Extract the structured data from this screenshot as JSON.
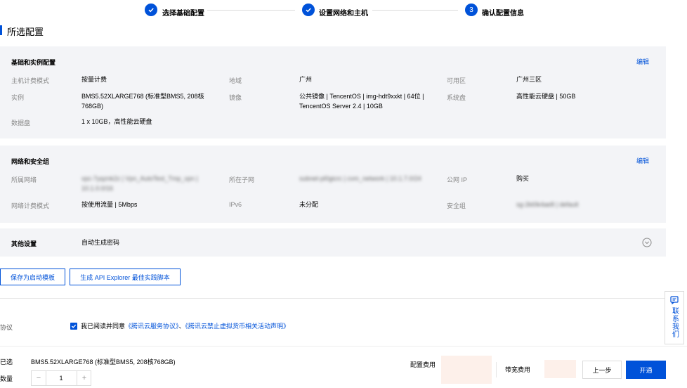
{
  "steps": [
    {
      "index": "1",
      "label": "选择基础配置",
      "status": "done"
    },
    {
      "index": "2",
      "label": "设置网络和主机",
      "status": "done"
    },
    {
      "index": "3",
      "label": "确认配置信息",
      "status": "current"
    }
  ],
  "page_title": "所选配置",
  "basic": {
    "title": "基础和实例配置",
    "edit": "编辑",
    "billing_label": "主机计费模式",
    "billing_value": "按量计费",
    "region_label": "地域",
    "region_value": "广州",
    "zone_label": "可用区",
    "zone_value": "广州三区",
    "instance_label": "实例",
    "instance_value_1": "BMS5.52XLARGE768 (标准型BMS5, 208核",
    "instance_value_2": "768GB)",
    "image_label": "镜像",
    "image_value_1": "公共镜像 | TencentOS | img-hdt9xxkt | 64位 |",
    "image_value_2": "TencentOS Server 2.4 | 10GB",
    "sysdisk_label": "系统盘",
    "sysdisk_value": "高性能云硬盘 | 50GB",
    "datadisk_label": "数据盘",
    "datadisk_value": "1 x 10GB，高性能云硬盘"
  },
  "network": {
    "title": "网络和安全组",
    "edit": "编辑",
    "vpc_label": "所属网络",
    "vpc_value_1": "vpc-7yqznk2z | Vpn_AutoTest_Tmp_vpn |",
    "vpc_value_2": "10.1.0.0/16",
    "subnet_label": "所在子网",
    "subnet_value": "subnet-pl0gicrc | cvm_network | 10.1.7.0/24",
    "publicip_label": "公网 IP",
    "publicip_value": "购买",
    "netbilling_label": "网络计费模式",
    "netbilling_value": "按使用流量 | 5Mbps",
    "ipv6_label": "IPv6",
    "ipv6_value": "未分配",
    "sg_label": "安全组",
    "sg_value": "sg-2kt0k4ae8 | default"
  },
  "other": {
    "title": "其他设置",
    "value": "自动生成密码"
  },
  "actions": {
    "save_template": "保存为启动模板",
    "api_explorer": "生成 API Explorer 最佳实践脚本"
  },
  "agreement": {
    "label": "协议",
    "text": "我已阅读并同意",
    "link1": "《腾讯云服务协议》",
    "sep": "、",
    "link2": "《腾讯云禁止虚拟货币相关活动声明》",
    "checked": true
  },
  "contact": {
    "text": "联系我们"
  },
  "footer": {
    "selected_label": "已选",
    "selected_value": "BMS5.52XLARGE768 (标准型BMS5, 208核768GB)",
    "quantity_label": "数量",
    "quantity_value": "1",
    "minus": "−",
    "plus": "+",
    "config_fee_label": "配置费用",
    "bandwidth_fee_label": "带宽费用",
    "prev": "上一步",
    "submit": "开通"
  },
  "colors": {
    "accent": "#0052d9",
    "panel_bg": "#f3f4f7"
  }
}
